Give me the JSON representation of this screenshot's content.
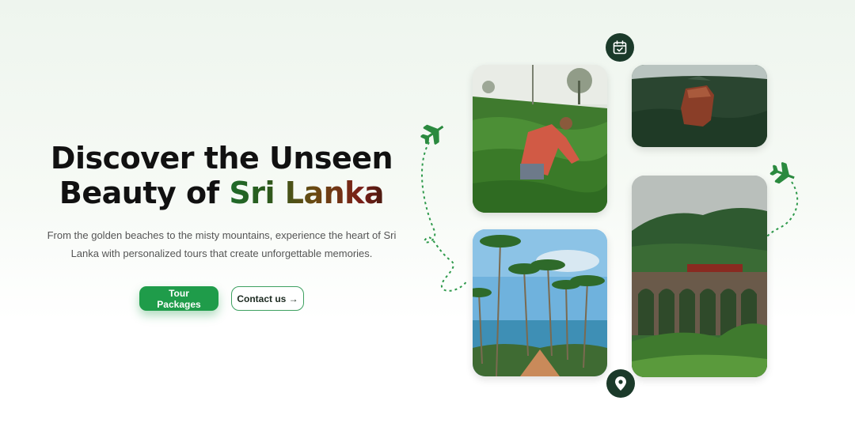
{
  "hero": {
    "title_line1": "Discover the Unseen",
    "title_line2_prefix": "Beauty of ",
    "title_accent": "Sri Lanka",
    "description": "From the golden beaches to the misty mountains, experience the heart of Sri Lanka with personalized tours that create unforgettable memories."
  },
  "cta": {
    "primary_label": "Tour Packages",
    "secondary_label": "Contact us →"
  },
  "icons": {
    "top_badge": "calendar-check-icon",
    "bottom_badge": "location-pin-icon",
    "decor_left": "airplane-icon",
    "decor_right": "airplane-icon"
  },
  "gallery": [
    "tea-plantation",
    "sigiriya-rock",
    "palm-beach",
    "nine-arch-bridge"
  ],
  "colors": {
    "brand_green": "#1f9c4a",
    "badge_dark": "#1b3a2a",
    "accent_gradient": [
      "#1f6b2a",
      "#6a4a12",
      "#7a1f18"
    ]
  }
}
